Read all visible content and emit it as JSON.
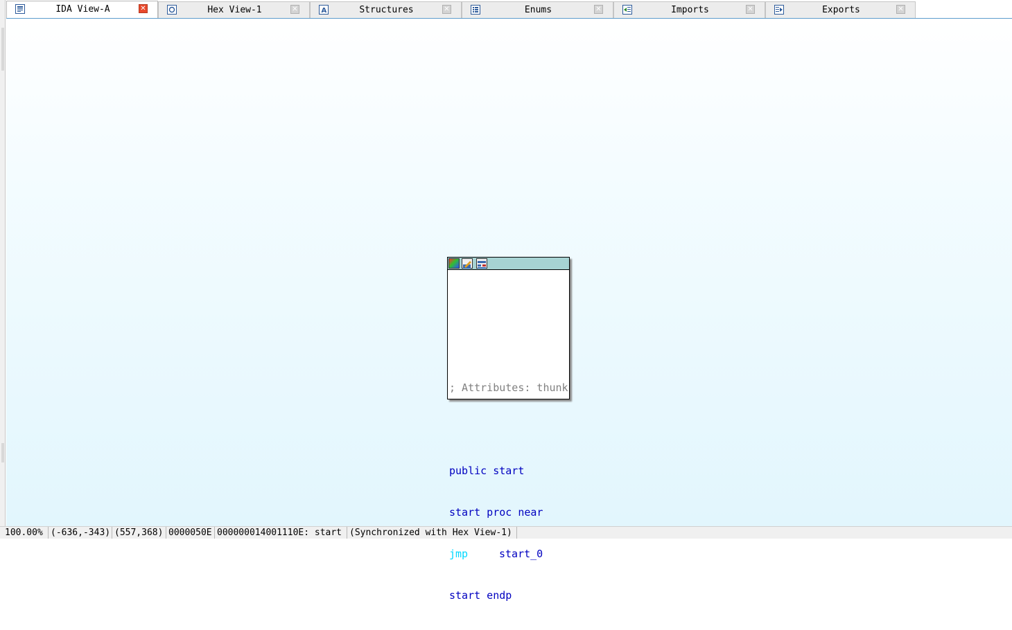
{
  "tabs": [
    {
      "label": "IDA View-A",
      "icon": "ida-view-icon",
      "active": true
    },
    {
      "label": "Hex View-1",
      "icon": "hex-view-icon",
      "active": false
    },
    {
      "label": "Structures",
      "icon": "structures-icon",
      "active": false
    },
    {
      "label": "Enums",
      "icon": "enums-icon",
      "active": false
    },
    {
      "label": "Imports",
      "icon": "imports-icon",
      "active": false
    },
    {
      "label": "Exports",
      "icon": "exports-icon",
      "active": false
    }
  ],
  "graph": {
    "node": {
      "buttons": [
        "color-picker-icon",
        "rename-node-icon",
        "group-nodes-icon"
      ],
      "lines": {
        "comment": "; Attributes: thunk",
        "public_decl": "public start",
        "proc_decl": "start proc near",
        "instr_mnemonic": "jmp",
        "instr_operand": "start_0",
        "endp": "start endp"
      }
    }
  },
  "status": {
    "zoom": "100.00%",
    "graph_coords": "(-636,-343)",
    "mouse_coords": "(557,368)",
    "file_offset": "0000050E",
    "location": "000000014001110E: start",
    "sync": "(Synchronized with Hex View-1)"
  },
  "colors": {
    "accent": "#5c9ccc",
    "active_close": "#e8492c",
    "node_title": "#a7d3d3",
    "keyword": "#0000c0",
    "jump": "#00d8ff",
    "comment": "#808080"
  }
}
